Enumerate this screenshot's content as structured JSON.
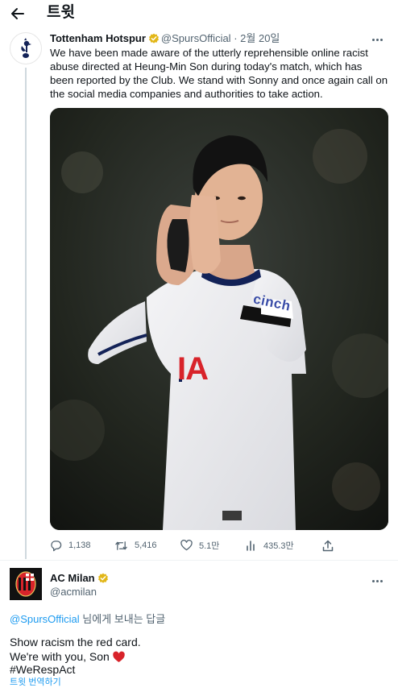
{
  "header": {
    "title": "트윗"
  },
  "tweet1": {
    "name": "Tottenham Hotspur",
    "handle": "@SpursOfficial",
    "separator": "·",
    "time": "2월 20일",
    "text": "We have been made aware of the utterly reprehensible online racist abuse directed at Heung-Min Son during today's match, which has been reported by the Club. We stand with Sonny and once again call on the social media companies and authorities to take action.",
    "shirt_sponsor": "cinch",
    "shirt_letters": "IA",
    "actions": {
      "replies": "1,138",
      "retweets": "5,416",
      "likes": "5.1만",
      "views": "435.3만"
    }
  },
  "tweet2": {
    "name": "AC Milan",
    "handle": "@acmilan",
    "reply_handle": "@SpursOfficial",
    "reply_suffix": " 님에게 보내는 답글",
    "line1": "Show racism the red card.",
    "line2": "We're with you, Son",
    "hashtag": "#WeRespAct",
    "translate": "트윗 번역하기"
  },
  "colors": {
    "link": "#1d9bf0",
    "verified_gold": "#e2b719",
    "muted": "#536471",
    "milan_red": "#d8232a"
  }
}
